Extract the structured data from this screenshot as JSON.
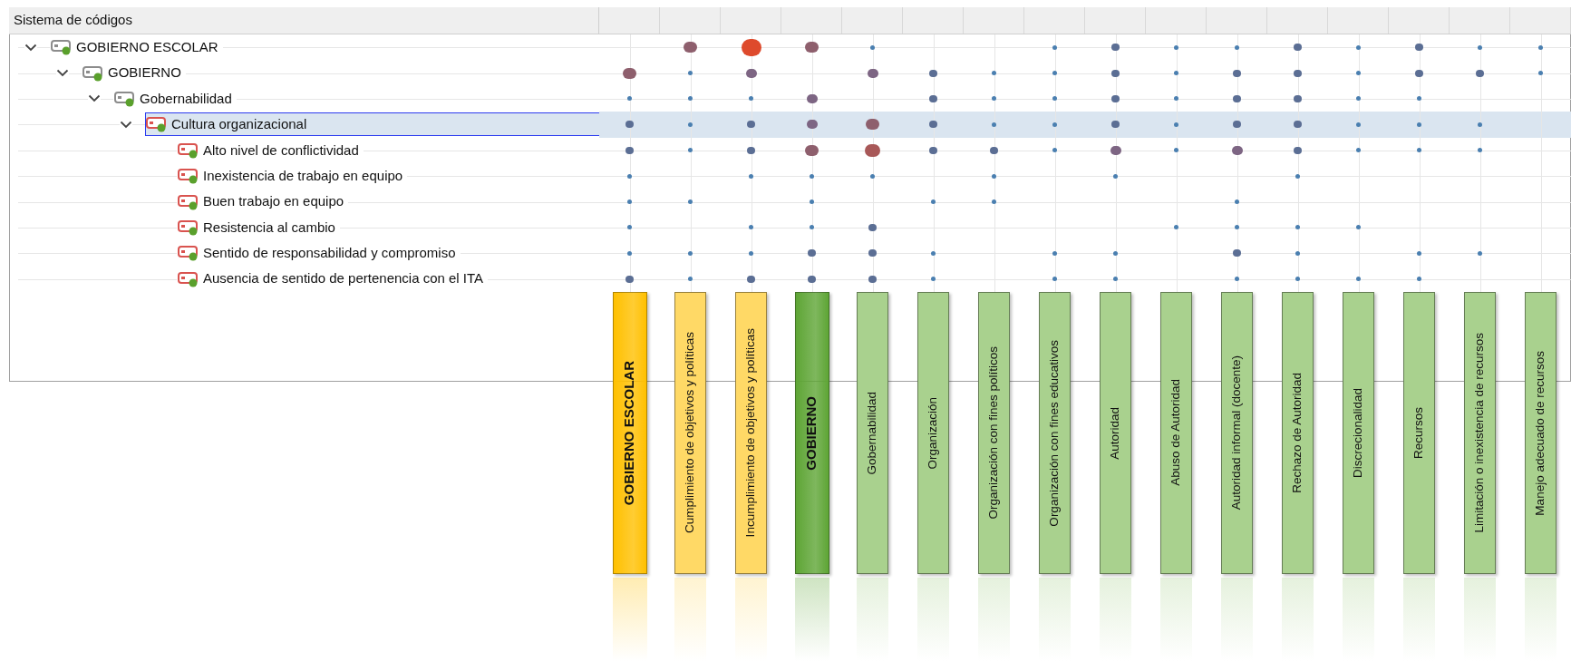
{
  "header": {
    "title": "Sistema de códigos"
  },
  "tree": [
    {
      "label": "GOBIERNO ESCOLAR",
      "color": "#8c8c8c",
      "expanded": true,
      "selected": false,
      "cells": [
        {
          "kind": "none"
        },
        {
          "kind": "l"
        },
        {
          "kind": "xl"
        },
        {
          "kind": "l"
        },
        {
          "kind": "xs"
        },
        {
          "kind": "none"
        },
        {
          "kind": "none"
        },
        {
          "kind": "xs"
        },
        {
          "kind": "s"
        },
        {
          "kind": "xs"
        },
        {
          "kind": "xs"
        },
        {
          "kind": "s"
        },
        {
          "kind": "xs"
        },
        {
          "kind": "s"
        },
        {
          "kind": "xs"
        },
        {
          "kind": "xs"
        }
      ],
      "children": [
        {
          "label": "GOBIERNO",
          "color": "#8c8c8c",
          "expanded": true,
          "selected": false,
          "cells": [
            {
              "kind": "l"
            },
            {
              "kind": "xs"
            },
            {
              "kind": "m"
            },
            {
              "kind": "none"
            },
            {
              "kind": "m"
            },
            {
              "kind": "s"
            },
            {
              "kind": "xs"
            },
            {
              "kind": "xs"
            },
            {
              "kind": "s"
            },
            {
              "kind": "xs"
            },
            {
              "kind": "s"
            },
            {
              "kind": "s"
            },
            {
              "kind": "xs"
            },
            {
              "kind": "s"
            },
            {
              "kind": "s"
            },
            {
              "kind": "xs"
            }
          ],
          "children": [
            {
              "label": "Gobernabilidad",
              "color": "#8c8c8c",
              "expanded": true,
              "selected": false,
              "cells": [
                {
                  "kind": "xs"
                },
                {
                  "kind": "xs"
                },
                {
                  "kind": "xs"
                },
                {
                  "kind": "m"
                },
                {
                  "kind": "none"
                },
                {
                  "kind": "s"
                },
                {
                  "kind": "xs"
                },
                {
                  "kind": "xs"
                },
                {
                  "kind": "s"
                },
                {
                  "kind": "xs"
                },
                {
                  "kind": "s"
                },
                {
                  "kind": "s"
                },
                {
                  "kind": "xs"
                },
                {
                  "kind": "xs"
                },
                {
                  "kind": "none"
                },
                {
                  "kind": "none"
                }
              ],
              "children": [
                {
                  "label": "Cultura organizacional",
                  "color": "#d9534f",
                  "expanded": true,
                  "selected": true,
                  "cells": [
                    {
                      "kind": "s"
                    },
                    {
                      "kind": "xs"
                    },
                    {
                      "kind": "s"
                    },
                    {
                      "kind": "m"
                    },
                    {
                      "kind": "l"
                    },
                    {
                      "kind": "s"
                    },
                    {
                      "kind": "xs"
                    },
                    {
                      "kind": "xs"
                    },
                    {
                      "kind": "s"
                    },
                    {
                      "kind": "xs"
                    },
                    {
                      "kind": "s"
                    },
                    {
                      "kind": "s"
                    },
                    {
                      "kind": "xs"
                    },
                    {
                      "kind": "xs"
                    },
                    {
                      "kind": "xs"
                    },
                    {
                      "kind": "none"
                    }
                  ],
                  "children": [
                    {
                      "label": "Alto nivel de conflictividad",
                      "color": "#d9534f",
                      "selected": false,
                      "cells": [
                        {
                          "kind": "s"
                        },
                        {
                          "kind": "xs"
                        },
                        {
                          "kind": "s"
                        },
                        {
                          "kind": "l"
                        },
                        {
                          "kind": "lr"
                        },
                        {
                          "kind": "s"
                        },
                        {
                          "kind": "s"
                        },
                        {
                          "kind": "xs"
                        },
                        {
                          "kind": "m"
                        },
                        {
                          "kind": "xs"
                        },
                        {
                          "kind": "m"
                        },
                        {
                          "kind": "s"
                        },
                        {
                          "kind": "xs"
                        },
                        {
                          "kind": "xs"
                        },
                        {
                          "kind": "xs"
                        },
                        {
                          "kind": "none"
                        }
                      ]
                    },
                    {
                      "label": "Inexistencia de trabajo en equipo",
                      "color": "#d9534f",
                      "selected": false,
                      "cells": [
                        {
                          "kind": "xs"
                        },
                        {
                          "kind": "none"
                        },
                        {
                          "kind": "xs"
                        },
                        {
                          "kind": "xs"
                        },
                        {
                          "kind": "xs"
                        },
                        {
                          "kind": "none"
                        },
                        {
                          "kind": "xs"
                        },
                        {
                          "kind": "none"
                        },
                        {
                          "kind": "xs"
                        },
                        {
                          "kind": "none"
                        },
                        {
                          "kind": "none"
                        },
                        {
                          "kind": "xs"
                        },
                        {
                          "kind": "none"
                        },
                        {
                          "kind": "none"
                        },
                        {
                          "kind": "none"
                        },
                        {
                          "kind": "none"
                        }
                      ]
                    },
                    {
                      "label": "Buen trabajo en equipo",
                      "color": "#d9534f",
                      "selected": false,
                      "cells": [
                        {
                          "kind": "xs"
                        },
                        {
                          "kind": "xs"
                        },
                        {
                          "kind": "none"
                        },
                        {
                          "kind": "xs"
                        },
                        {
                          "kind": "none"
                        },
                        {
                          "kind": "xs"
                        },
                        {
                          "kind": "xs"
                        },
                        {
                          "kind": "none"
                        },
                        {
                          "kind": "none"
                        },
                        {
                          "kind": "none"
                        },
                        {
                          "kind": "xs"
                        },
                        {
                          "kind": "none"
                        },
                        {
                          "kind": "none"
                        },
                        {
                          "kind": "none"
                        },
                        {
                          "kind": "none"
                        },
                        {
                          "kind": "none"
                        }
                      ]
                    },
                    {
                      "label": "Resistencia al cambio",
                      "color": "#d9534f",
                      "selected": false,
                      "cells": [
                        {
                          "kind": "xs"
                        },
                        {
                          "kind": "none"
                        },
                        {
                          "kind": "xs"
                        },
                        {
                          "kind": "xs"
                        },
                        {
                          "kind": "s"
                        },
                        {
                          "kind": "none"
                        },
                        {
                          "kind": "none"
                        },
                        {
                          "kind": "none"
                        },
                        {
                          "kind": "none"
                        },
                        {
                          "kind": "xs"
                        },
                        {
                          "kind": "xs"
                        },
                        {
                          "kind": "xs"
                        },
                        {
                          "kind": "xs"
                        },
                        {
                          "kind": "none"
                        },
                        {
                          "kind": "none"
                        },
                        {
                          "kind": "none"
                        }
                      ]
                    },
                    {
                      "label": "Sentido de responsabilidad y compromiso",
                      "color": "#d9534f",
                      "selected": false,
                      "cells": [
                        {
                          "kind": "xs"
                        },
                        {
                          "kind": "xs"
                        },
                        {
                          "kind": "xs"
                        },
                        {
                          "kind": "s"
                        },
                        {
                          "kind": "s"
                        },
                        {
                          "kind": "xs"
                        },
                        {
                          "kind": "none"
                        },
                        {
                          "kind": "xs"
                        },
                        {
                          "kind": "xs"
                        },
                        {
                          "kind": "none"
                        },
                        {
                          "kind": "s"
                        },
                        {
                          "kind": "xs"
                        },
                        {
                          "kind": "none"
                        },
                        {
                          "kind": "xs"
                        },
                        {
                          "kind": "xs"
                        },
                        {
                          "kind": "none"
                        }
                      ]
                    },
                    {
                      "label": "Ausencia de sentido de pertenencia con el ITA",
                      "color": "#d9534f",
                      "selected": false,
                      "cells": [
                        {
                          "kind": "s"
                        },
                        {
                          "kind": "xs"
                        },
                        {
                          "kind": "s"
                        },
                        {
                          "kind": "s"
                        },
                        {
                          "kind": "s"
                        },
                        {
                          "kind": "xs"
                        },
                        {
                          "kind": "none"
                        },
                        {
                          "kind": "xs"
                        },
                        {
                          "kind": "xs"
                        },
                        {
                          "kind": "none"
                        },
                        {
                          "kind": "xs"
                        },
                        {
                          "kind": "xs"
                        },
                        {
                          "kind": "xs"
                        },
                        {
                          "kind": "xs"
                        },
                        {
                          "kind": "none"
                        },
                        {
                          "kind": "none"
                        }
                      ]
                    }
                  ]
                }
              ]
            }
          ]
        }
      ]
    }
  ],
  "columns": [
    {
      "label": "GOBIERNO ESCOLAR",
      "kind": "parent",
      "color": "#ffc000"
    },
    {
      "label": "Cumplimiento de objetivos y políticas",
      "kind": "child",
      "color": "#ffd966"
    },
    {
      "label": "Incumplimiento de objetivos y políticas",
      "kind": "child",
      "color": "#ffd966"
    },
    {
      "label": "GOBIERNO",
      "kind": "parent",
      "color": "#5ea535"
    },
    {
      "label": "Gobernabilidad",
      "kind": "child",
      "color": "#a9d18e"
    },
    {
      "label": "Organización",
      "kind": "child",
      "color": "#a9d18e"
    },
    {
      "label": "Organización con fines políticos",
      "kind": "child",
      "color": "#a9d18e"
    },
    {
      "label": "Organización con fines educativos",
      "kind": "child",
      "color": "#a9d18e"
    },
    {
      "label": "Autoridad",
      "kind": "child",
      "color": "#a9d18e"
    },
    {
      "label": "Abuso de Autoridad",
      "kind": "child",
      "color": "#a9d18e"
    },
    {
      "label": "Autoridad informal (docente)",
      "kind": "child",
      "color": "#a9d18e"
    },
    {
      "label": "Rechazo de Autoridad",
      "kind": "child",
      "color": "#a9d18e"
    },
    {
      "label": "Discrecionalidad",
      "kind": "child",
      "color": "#a9d18e"
    },
    {
      "label": "Recursos",
      "kind": "child",
      "color": "#a9d18e"
    },
    {
      "label": "Limitación o inexistencia de recursos",
      "kind": "child",
      "color": "#a9d18e"
    },
    {
      "label": "Manejo adecuado de recursos",
      "kind": "child",
      "color": "#a9d18e"
    }
  ]
}
